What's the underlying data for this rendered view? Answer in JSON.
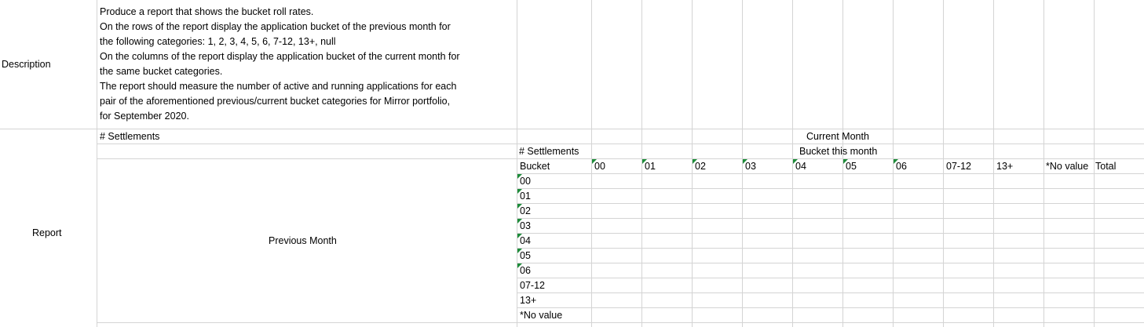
{
  "description": {
    "label": "Description",
    "lines": [
      "Produce a report that shows the bucket roll rates.",
      "On the rows of the report display the application bucket of the previous month for",
      "the following categories: 1, 2, 3, 4, 5, 6, 7-12, 13+, null",
      "On the columns of the report display the application bucket of the current month for",
      "the same bucket categories.",
      "The report should measure the number of active and running applications for each",
      "pair of the aforementioned previous/current bucket categories for Mirror portfolio,",
      "for September 2020."
    ]
  },
  "report": {
    "label": "Report",
    "top_settlements": "# Settlements",
    "current_month": "Current Month",
    "settlements": "# Settlements",
    "bucket_this_month": "Bucket this month",
    "bucket_header": "Bucket",
    "previous_month": "Previous Month",
    "columns": [
      "00",
      "01",
      "02",
      "03",
      "04",
      "05",
      "06",
      "07-12",
      "13+",
      "*No value",
      "Total"
    ],
    "rows": [
      "00",
      "01",
      "02",
      "03",
      "04",
      "05",
      "06",
      "07-12",
      "13+",
      "*No value"
    ]
  },
  "colors": {
    "grid": "#d4d4d4",
    "error_indicator": "#1e8c3a"
  }
}
